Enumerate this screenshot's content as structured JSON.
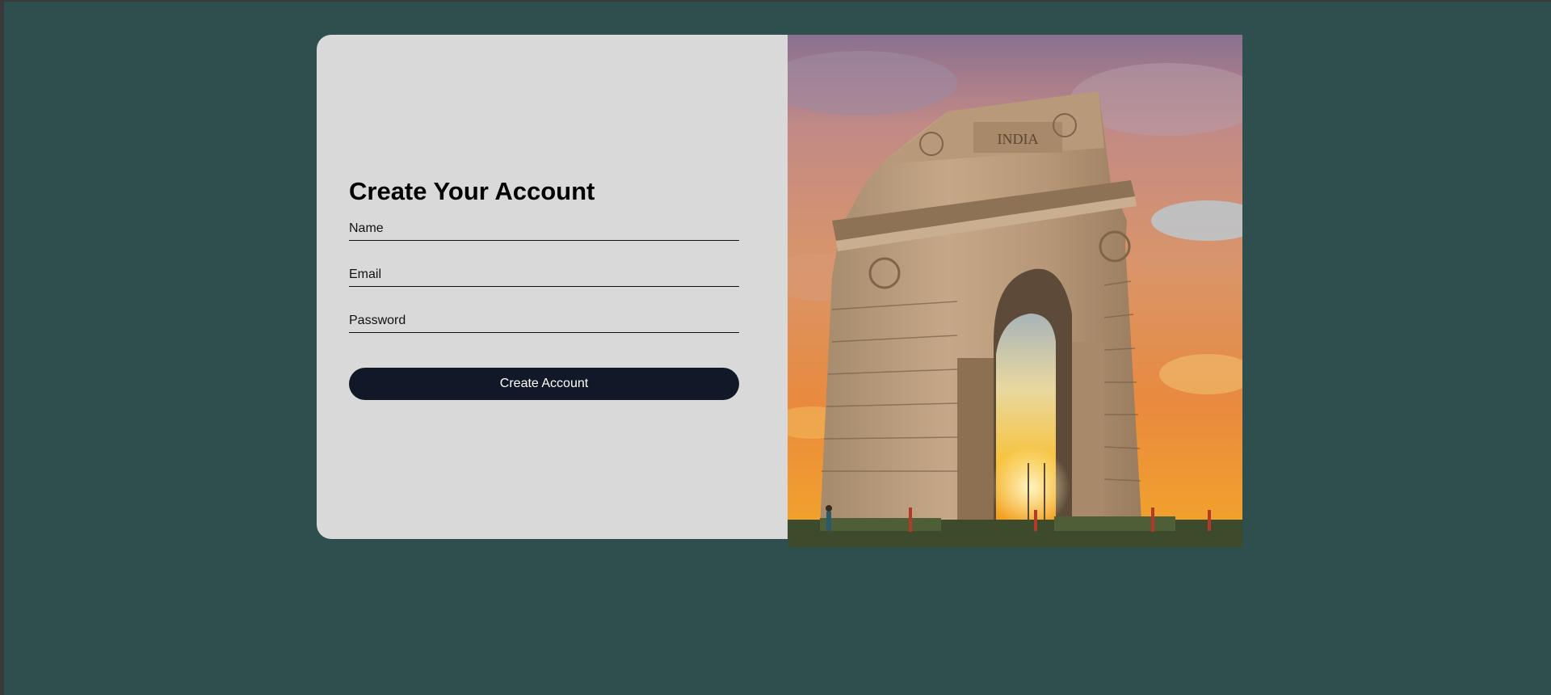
{
  "signup": {
    "title": "Create Your Account",
    "name_placeholder": "Name",
    "email_placeholder": "Email",
    "password_placeholder": "Password",
    "submit_label": "Create Account"
  },
  "hero_image": {
    "inscription": "INDIA",
    "subject": "india-gate-sunset"
  },
  "colors": {
    "page_background": "#2f4f4f",
    "card_background": "#d9d9d9",
    "button_background": "#111827",
    "button_text": "#ffffff"
  }
}
